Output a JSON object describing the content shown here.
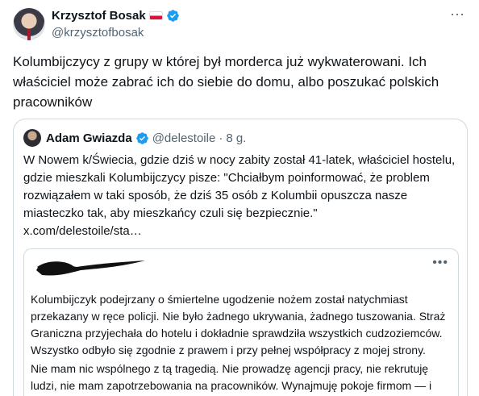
{
  "author": {
    "name": "Krzysztof Bosak",
    "handle": "@krzysztofbosak"
  },
  "icons": {
    "flag": "poland-flag-icon",
    "verified": "verified-badge-icon",
    "more": "more-options-icon"
  },
  "colors": {
    "verified": "#1d9bf0",
    "secondary_text": "#536471",
    "border": "#cfd9de"
  },
  "more_label": "···",
  "tweet_text": "Kolumbijczycy z grupy w której był morderca już wykwaterowani. Ich właściciel może zabrać ich do siebie do domu, albo poszukać polskich pracowników",
  "quote": {
    "name": "Adam Gwiazda",
    "handle": "@delestoile",
    "separator": "·",
    "time": "8 g.",
    "text": "W Nowem k/Świecia, gdzie dziś w nocy zabity został 41-latek, właściciel hostelu, gdzie mieszkali Kolumbijczycy pisze: \"Chciałbym poinformować, że problem rozwiązałem w taki sposób, że dziś 35 osób z Kolumbii opuszcza nasze miasteczko tak, aby mieszkańcy czuli się bezpiecznie.\"",
    "link": "x.com/delestoile/sta…"
  },
  "embedded": {
    "more_label": "•••",
    "paragraph1": "Kolumbijczyk podejrzany o śmiertelne ugodzenie nożem został natychmiast przekazany w ręce policji. Nie było żadnego ukrywania, żadnego tuszowania. Straż Graniczna przyjechała do hotelu i dokładnie sprawdziła wszystkich cudzoziemców. Wszystko odbyło się zgodnie z prawem i przy pełnej współpracy z mojej strony.",
    "paragraph2": "Nie mam nic wspólnego z tą tragedią. Nie prowadzę agencji pracy, nie rekrutuję ludzi, nie mam zapotrzebowania na pracowników. Wynajmuję pokoje firmom — i tylko tyle."
  }
}
